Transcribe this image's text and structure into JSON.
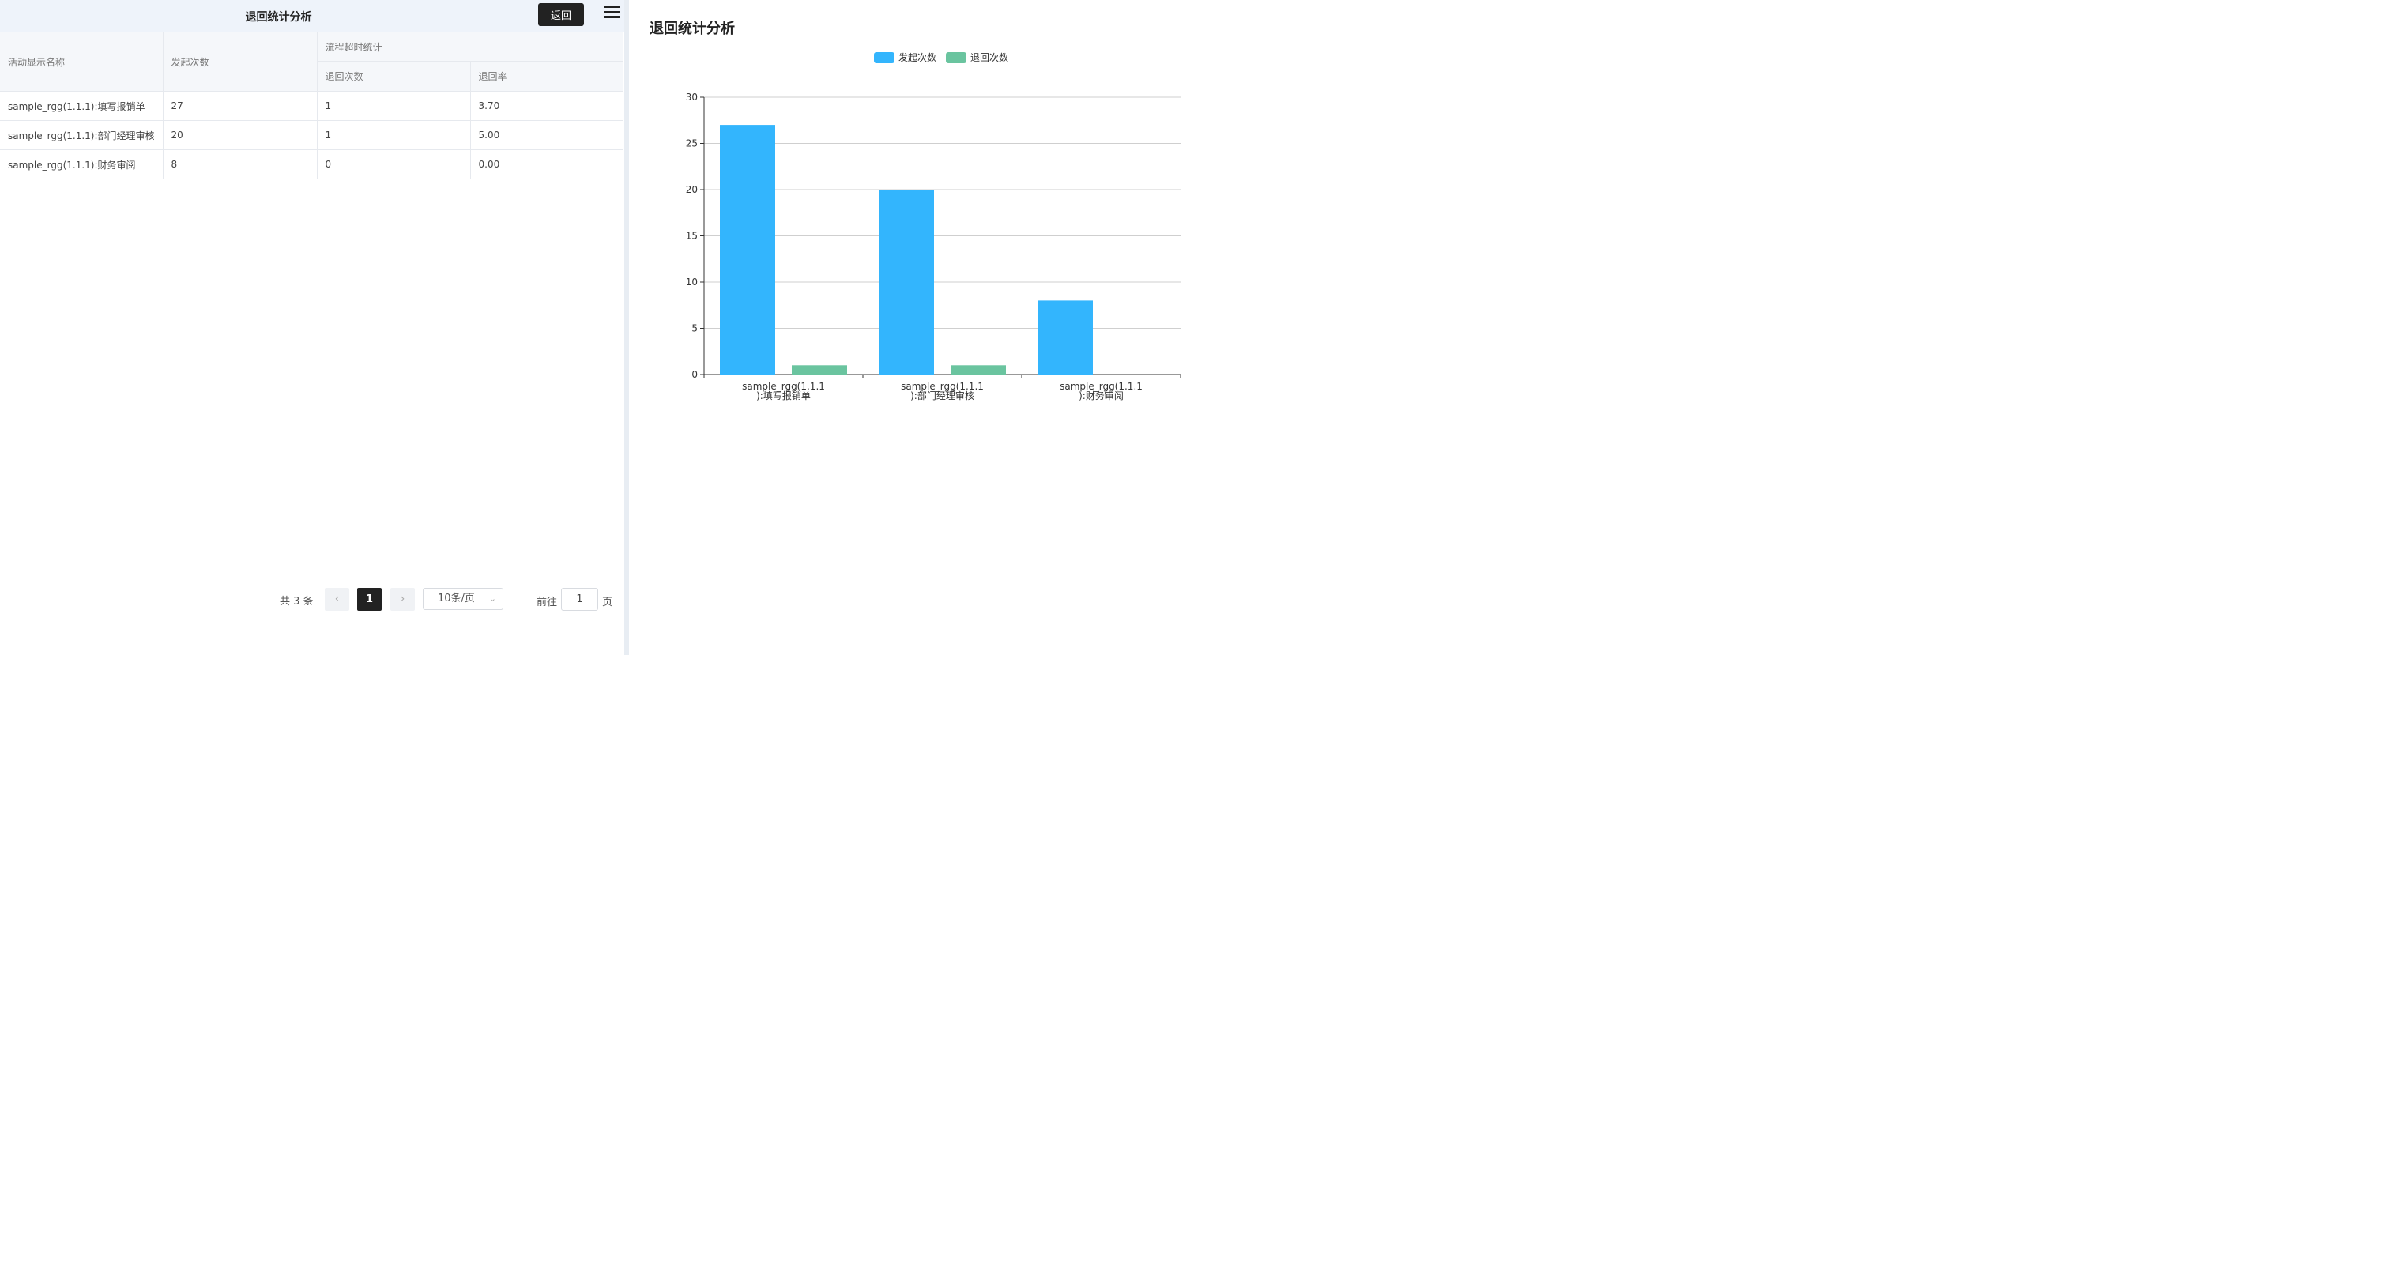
{
  "header": {
    "title": "退回统计分析",
    "back_label": "返回"
  },
  "table": {
    "col_name": "活动显示名称",
    "col_initiated": "发起次数",
    "group_label": "流程超时统计",
    "col_returned": "退回次数",
    "col_rate": "退回率",
    "rows": [
      {
        "name": "sample_rgg(1.1.1):填写报销单",
        "initiated": "27",
        "returned": "1",
        "rate": "3.70"
      },
      {
        "name": "sample_rgg(1.1.1):部门经理审核",
        "initiated": "20",
        "returned": "1",
        "rate": "5.00"
      },
      {
        "name": "sample_rgg(1.1.1):财务审阅",
        "initiated": "8",
        "returned": "0",
        "rate": "0.00"
      }
    ]
  },
  "pagination": {
    "total": "共 3 条",
    "prev_icon": "chevron-left-icon",
    "next_icon": "chevron-right-icon",
    "current_page": "1",
    "page_size": "10条/页",
    "goto_label": "前往",
    "goto_value": "1",
    "page_suffix": "页"
  },
  "chart": {
    "title": "退回统计分析"
  },
  "chart_data": {
    "type": "bar",
    "title": "退回统计分析",
    "categories": [
      "sample_rgg(1.1.1):填写报销单",
      "sample_rgg(1.1.1):部门经理审核",
      "sample_rgg(1.1.1):财务审阅"
    ],
    "category_label_lines": [
      [
        "sample_rgg(1.1.1",
        "):填写报销单"
      ],
      [
        "sample_rgg(1.1.1",
        "):部门经理审核"
      ],
      [
        "sample_rgg(1.1.1",
        "):财务审阅"
      ]
    ],
    "series": [
      {
        "name": "发起次数",
        "values": [
          27,
          20,
          8
        ],
        "color": "#33b5fd"
      },
      {
        "name": "退回次数",
        "values": [
          1,
          1,
          0
        ],
        "color": "#6ac49f"
      }
    ],
    "ylim": [
      0,
      30
    ],
    "yticks": [
      0,
      5,
      10,
      15,
      20,
      25,
      30
    ],
    "grid": true,
    "legend": "top-center"
  }
}
